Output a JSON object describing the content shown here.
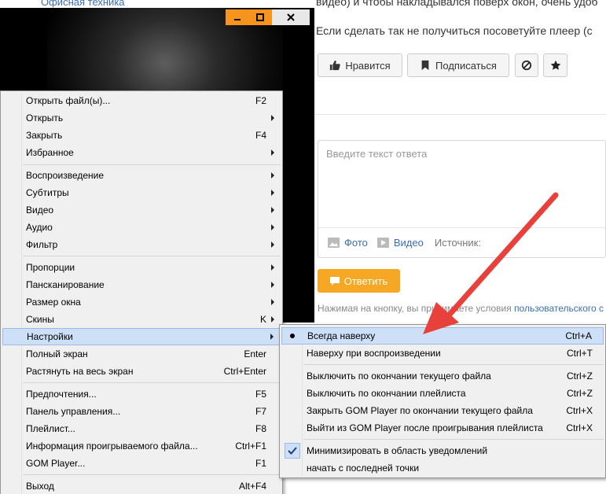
{
  "background_page": {
    "sidebar_link": "Офисная техника",
    "text_line_1": "видео) и чтобы накладывался поверх окон, очень удоб",
    "text_line_2": "Если сделать так не получиться посоветуйте плеер (с",
    "buttons": {
      "like": "Нравится",
      "subscribe": "Подписаться"
    },
    "answer_placeholder": "Введите текст ответа",
    "attachments": {
      "photo": "Фото",
      "video": "Видео",
      "source": "Источник:"
    },
    "reply_button": "Ответить",
    "terms_prefix": "Нажимая на кнопку, вы принимаете условия ",
    "terms_link": "пользовательского с"
  },
  "player": {
    "buttons": [
      "minimize",
      "maximize",
      "close"
    ]
  },
  "main_menu": {
    "items": [
      {
        "label": "Открыть файл(ы)...",
        "shortcut": "F2"
      },
      {
        "label": "Открыть",
        "submenu": true
      },
      {
        "label": "Закрыть",
        "shortcut": "F4"
      },
      {
        "label": "Избранное",
        "submenu": true
      },
      {
        "label": "Воспроизведение",
        "submenu": true
      },
      {
        "label": "Субтитры",
        "submenu": true
      },
      {
        "label": "Видео",
        "submenu": true
      },
      {
        "label": "Аудио",
        "submenu": true
      },
      {
        "label": "Фильтр",
        "submenu": true
      },
      {
        "label": "Пропорции",
        "submenu": true
      },
      {
        "label": "Пансканирование",
        "submenu": true
      },
      {
        "label": "Размер окна",
        "submenu": true
      },
      {
        "label": "Скины",
        "shortcut": "K",
        "submenu": true
      },
      {
        "label": "Настройки",
        "submenu": true,
        "highlighted": true
      },
      {
        "label": "Полный экран",
        "shortcut": "Enter"
      },
      {
        "label": "Растянуть на весь экран",
        "shortcut": "Ctrl+Enter"
      },
      {
        "label": "Предпочтения...",
        "shortcut": "F5"
      },
      {
        "label": "Панель управления...",
        "shortcut": "F7"
      },
      {
        "label": "Плейлист...",
        "shortcut": "F8"
      },
      {
        "label": "Информация проигрываемого файла...",
        "shortcut": "Ctrl+F1"
      },
      {
        "label": "GOM Player...",
        "shortcut": "F1"
      },
      {
        "label": "Выход",
        "shortcut": "Alt+F4"
      }
    ]
  },
  "sub_menu": {
    "items": [
      {
        "label": "Всегда наверху",
        "shortcut": "Ctrl+A",
        "state": "bullet",
        "highlighted": true
      },
      {
        "label": "Наверху при воспроизведении",
        "shortcut": "Ctrl+T"
      },
      {
        "label": "Выключить по окончании текущего файла",
        "shortcut": "Ctrl+Z"
      },
      {
        "label": "Выключить по окончании плейлиста",
        "shortcut": "Ctrl+Z"
      },
      {
        "label": "Закрыть GOM Player по окончании текущего файла",
        "shortcut": "Ctrl+X"
      },
      {
        "label": "Выйти из GOM Player после проигрывания плейлиста",
        "shortcut": "Ctrl+X"
      },
      {
        "label": "Минимизировать в область уведомлений",
        "state": "check"
      },
      {
        "label": "начать с последней точки"
      }
    ]
  },
  "annotation": {
    "arrow_color": "#e8403a"
  },
  "colors": {
    "accent_orange": "#f6a723",
    "link_blue": "#3a6fb5",
    "menu_highlight": "#cde0f7"
  }
}
